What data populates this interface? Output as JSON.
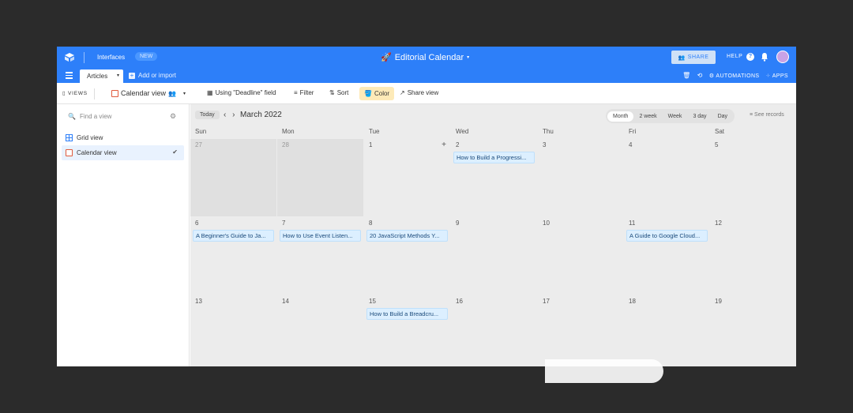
{
  "topbar": {
    "interfaces": "Interfaces",
    "new_badge": "NEW",
    "base_title": "Editorial Calendar",
    "share": "SHARE",
    "help": "HELP"
  },
  "tabbar": {
    "active_tab": "Articles",
    "add_import": "Add or import",
    "automations": "AUTOMATIONS",
    "apps": "APPS"
  },
  "toolbar": {
    "views": "VIEWS",
    "current_view": "Calendar view",
    "using_field": "Using \"Deadline\" field",
    "filter": "Filter",
    "sort": "Sort",
    "color": "Color",
    "share_view": "Share view"
  },
  "sidebar": {
    "search_placeholder": "Find a view",
    "views": [
      {
        "label": "Grid view",
        "active": false
      },
      {
        "label": "Calendar view",
        "active": true
      }
    ]
  },
  "calendar": {
    "today": "Today",
    "month": "March 2022",
    "ranges": [
      "Month",
      "2 week",
      "Week",
      "3 day",
      "Day"
    ],
    "selected_range": "Month",
    "see_records": "See records",
    "weekdays": [
      "Sun",
      "Mon",
      "Tue",
      "Wed",
      "Thu",
      "Fri",
      "Sat"
    ],
    "weeks": [
      [
        {
          "d": "27",
          "other": true
        },
        {
          "d": "28",
          "other": true
        },
        {
          "d": "1",
          "plus": true
        },
        {
          "d": "2",
          "event": "How to Build a Progressi..."
        },
        {
          "d": "3"
        },
        {
          "d": "4"
        },
        {
          "d": "5"
        }
      ],
      [
        {
          "d": "6",
          "event": "A Beginner's Guide to Ja..."
        },
        {
          "d": "7",
          "event": "How to Use Event Listen..."
        },
        {
          "d": "8",
          "event": "20 JavaScript Methods Y..."
        },
        {
          "d": "9"
        },
        {
          "d": "10"
        },
        {
          "d": "11",
          "event": "A Guide to Google Cloud..."
        },
        {
          "d": "12"
        }
      ],
      [
        {
          "d": "13"
        },
        {
          "d": "14"
        },
        {
          "d": "15",
          "event": "How to Build a Breadcru..."
        },
        {
          "d": "16"
        },
        {
          "d": "17"
        },
        {
          "d": "18"
        },
        {
          "d": "19"
        }
      ]
    ]
  }
}
